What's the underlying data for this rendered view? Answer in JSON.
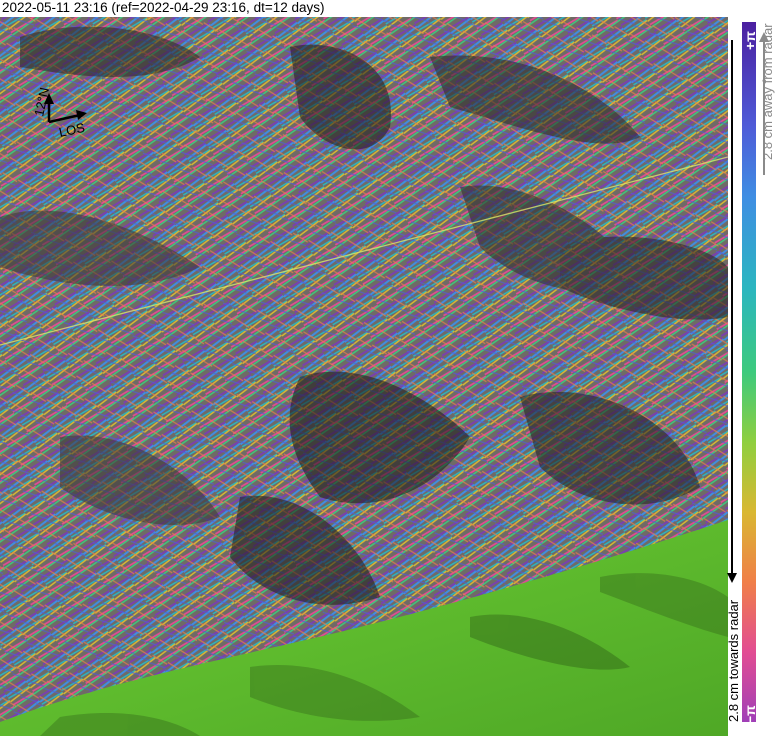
{
  "title": "2022-05-11 23:16 (ref=2022-04-29 23:16, dt=12 days)",
  "compass": {
    "north_label": "12°N",
    "los_label": "LOS"
  },
  "legend": {
    "max_label": "+π",
    "min_label": "−π",
    "away_label": "2.8 cm away from radar",
    "towards_label": "2.8 cm towards radar",
    "colors": [
      "#4b1fa0",
      "#4f5cd8",
      "#3f8ee3",
      "#2bb6c0",
      "#3dca7d",
      "#8fcf3f",
      "#d9b832",
      "#f07f48",
      "#e24d93",
      "#a03fb7"
    ]
  },
  "map": {
    "dem_color": "#5fbe2e",
    "fringe_colors": [
      "#7a3fb0",
      "#3f8ee3",
      "#2bb6c0",
      "#3dca7d",
      "#d9b832",
      "#e24d93",
      "#f07f48",
      "#4f5cd8"
    ]
  }
}
